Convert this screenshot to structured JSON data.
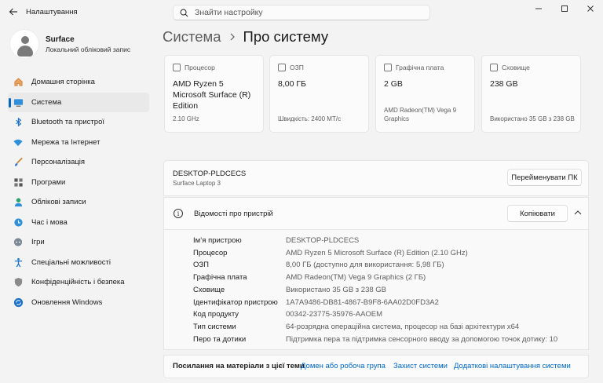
{
  "app": {
    "title": "Налаштування"
  },
  "search": {
    "placeholder": "Знайти настройку"
  },
  "profile": {
    "name": "Surface",
    "subtitle": "Локальний обліковий запис"
  },
  "sidebar": {
    "items": [
      {
        "label": "Домашня сторінка",
        "icon": "home-icon"
      },
      {
        "label": "Система",
        "icon": "system-icon",
        "active": true
      },
      {
        "label": "Bluetooth та пристрої",
        "icon": "bluetooth-icon"
      },
      {
        "label": "Мережа та Інтернет",
        "icon": "wifi-icon"
      },
      {
        "label": "Персоналізація",
        "icon": "brush-icon"
      },
      {
        "label": "Програми",
        "icon": "apps-icon"
      },
      {
        "label": "Облікові записи",
        "icon": "accounts-icon"
      },
      {
        "label": "Час і мова",
        "icon": "time-language-icon"
      },
      {
        "label": "Ігри",
        "icon": "gaming-icon"
      },
      {
        "label": "Спеціальні можливості",
        "icon": "accessibility-icon"
      },
      {
        "label": "Конфіденційність і безпека",
        "icon": "shield-icon"
      },
      {
        "label": "Оновлення Windows",
        "icon": "update-icon"
      }
    ]
  },
  "breadcrumb": {
    "parent": "Система",
    "current": "Про систему"
  },
  "cards": [
    {
      "label": "Процесор",
      "value": "AMD Ryzen 5 Microsoft Surface (R) Edition",
      "sub": "2.10 GHz"
    },
    {
      "label": "ОЗП",
      "value": "8,00 ГБ",
      "sub": "Швидкість: 2400 МТ/с"
    },
    {
      "label": "Графічна плата",
      "value": "2 GB",
      "sub": "AMD Radeon(TM) Vega 9 Graphics"
    },
    {
      "label": "Сховище",
      "value": "238 GB",
      "sub": "Використано 35 GB з 238 GB"
    }
  ],
  "device": {
    "name": "DESKTOP-PLDCECS",
    "model": "Surface Laptop 3",
    "rename_label": "Перейменувати ПК"
  },
  "specs": {
    "title": "Відомості про пристрій",
    "copy_label": "Копіювати",
    "rows": [
      {
        "key": "Ім’я пристрою",
        "value": "DESKTOP-PLDCECS"
      },
      {
        "key": "Процесор",
        "value": "AMD Ryzen 5 Microsoft Surface (R) Edition (2.10 GHz)"
      },
      {
        "key": "ОЗП",
        "value": "8,00 ГБ (доступно для використання: 5,98 ГБ)"
      },
      {
        "key": "Графічна плата",
        "value": "AMD Radeon(TM) Vega 9 Graphics (2 ГБ)"
      },
      {
        "key": "Сховище",
        "value": "Використано 35 GB з 238 GB"
      },
      {
        "key": "Ідентифікатор пристрою",
        "value": "1A7A9486-DB81-4867-B9F8-6AA02D0FD3A2"
      },
      {
        "key": "Код продукту",
        "value": "00342-23775-35976-AAOEM"
      },
      {
        "key": "Тип системи",
        "value": "64-розрядна операційна система, процесор на базі архітектури x64"
      },
      {
        "key": "Перо та дотики",
        "value": "Підтримка пера та підтримка сенсорного вводу за допомогою точок дотику: 10"
      }
    ]
  },
  "links": {
    "title": "Посилання на матеріали з цієї теми",
    "items": [
      "Домен або робоча група",
      "Захист системи",
      "Додаткові налаштування системи"
    ]
  },
  "colors": {
    "accent": "#0067c0",
    "background": "#f3f3f3",
    "card": "#fbfbfb"
  }
}
